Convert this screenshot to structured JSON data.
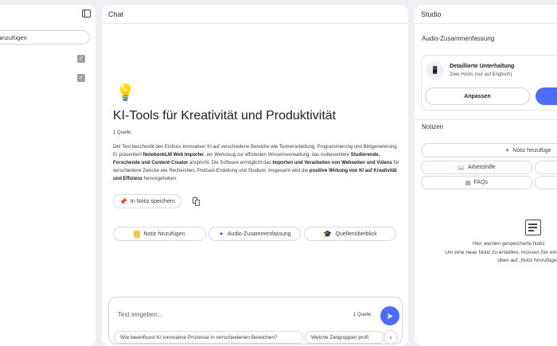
{
  "sources": {
    "add_label": "hinzufügen"
  },
  "chat": {
    "header": "Chat",
    "title": "KI-Tools für Kreativität und Produktivität",
    "source_count": "1 Quelle",
    "summary_parts": [
      "Der Text beschreibt den Einfluss innovativer KI auf verschiedene Bereiche wie Textverarbeitung, Programmierung und Bildgenerierung. Er präsentiert ",
      "NotebookLM Web Importer",
      ", ein Werkzeug zur effizienten Wissensverwaltung, das insbesondere ",
      "Studierende, Forschende und Content-Creator",
      " anspricht. Die Software ermöglicht das ",
      "Importen und Verarbeiten von Webseiten und Videos",
      " für verschiedene Zwecke wie Recherchen, Podcast-Erstellung und Studium. Insgesamt wird die ",
      "positive Wirkung von KI auf Kreativität und Effizienz",
      " hervorgehoben."
    ],
    "save_note_label": "In Notiz speichern",
    "actions": {
      "add_note": "Notiz hinzufügen",
      "audio_summary": "Audio-Zusammenfassung",
      "source_overview": "Quellenüberblick"
    },
    "input": {
      "placeholder": "Text eingeben...",
      "source_count": "1 Quelle"
    },
    "suggestions": [
      "Wie beeinflusst KI innovative Prozesse in verschiedenen Bereichen?",
      "Welche Zielgruppen profi"
    ]
  },
  "studio": {
    "header": "Studio",
    "audio_section_title": "Audio-Zusammenfassung",
    "audio_card": {
      "title": "Detaillierte Unterhaltung",
      "subtitle": "Zwei Hosts (nur auf Englisch)",
      "customize_label": "Anpassen"
    },
    "notes_section_title": "Notizen",
    "add_note_label": "Notiz hinzufüge",
    "note_types": [
      "Arbeitshilfe",
      "FAQs"
    ],
    "empty": {
      "title": "Hier werden gespeicherte Notiz",
      "line1": "Um eine neue Notiz zu erstellen, müssen Sie eine",
      "line2": "oben auf „Notiz hinzufügen"
    }
  },
  "colors": {
    "accent": "#4d6cf7",
    "background": "#eef0f3"
  }
}
